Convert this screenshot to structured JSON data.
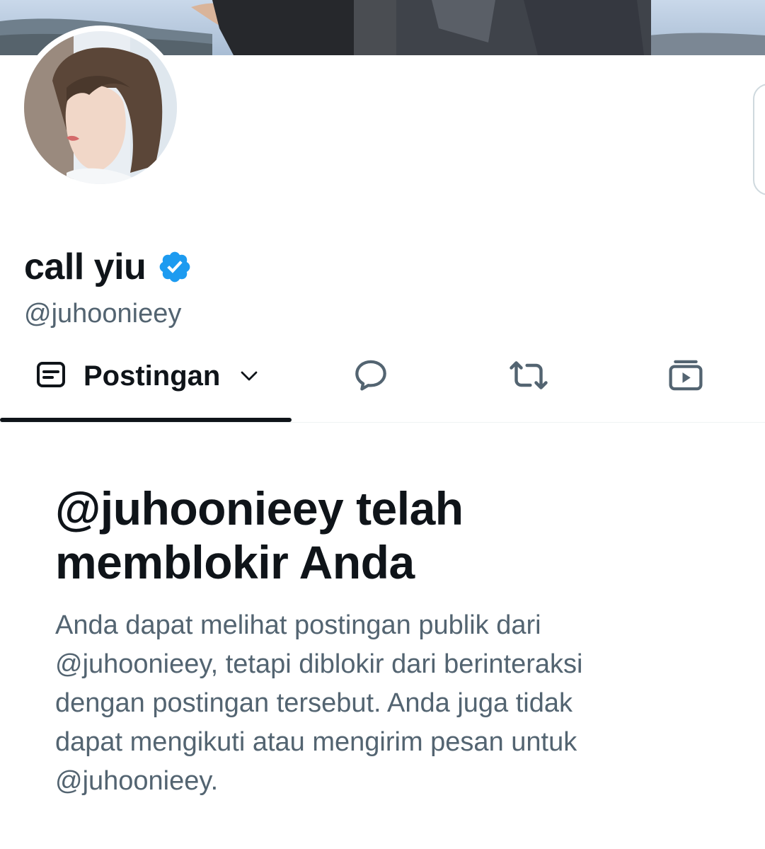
{
  "profile": {
    "display_name": "call yiu",
    "handle": "@juhoonieey",
    "verified": true,
    "verified_color": "#1d9bf0"
  },
  "tabs": [
    {
      "label": "Postingan",
      "icon": "posts-icon",
      "selected": true
    },
    {
      "label": "",
      "icon": "replies-icon",
      "selected": false
    },
    {
      "label": "",
      "icon": "reposts-icon",
      "selected": false
    },
    {
      "label": "",
      "icon": "media-icon",
      "selected": false
    }
  ],
  "blocked": {
    "title": "@juhoonieey telah memblokir Anda",
    "body": "Anda dapat melihat postingan publik dari\n@juhoonieey, tetapi diblokir dari berinteraksi\ndengan postingan tersebut. Anda juga tidak\ndapat mengikuti atau mengirim pesan untuk\n@juhoonieey."
  },
  "colors": {
    "text_primary": "#0f1419",
    "text_secondary": "#536471",
    "accent": "#1d9bf0"
  }
}
